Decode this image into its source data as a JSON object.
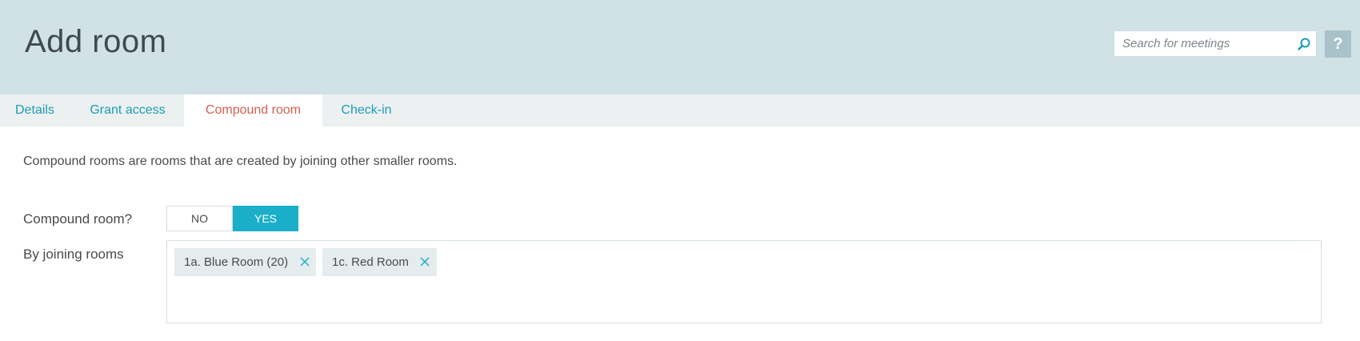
{
  "header": {
    "title": "Add room",
    "search_placeholder": "Search for meetings",
    "help_label": "?"
  },
  "tabs": [
    {
      "label": "Details",
      "active": false
    },
    {
      "label": "Grant access",
      "active": false
    },
    {
      "label": "Compound room",
      "active": true
    },
    {
      "label": "Check-in",
      "active": false
    }
  ],
  "content": {
    "description": "Compound rooms are rooms that are created by joining other smaller rooms.",
    "compound_label": "Compound room?",
    "toggle": {
      "no_label": "NO",
      "yes_label": "YES",
      "selected": "YES"
    },
    "joining_label": "By joining rooms",
    "rooms": [
      {
        "label": "1a. Blue Room (20)"
      },
      {
        "label": "1c. Red Room"
      }
    ]
  },
  "colors": {
    "header_bg": "#d1e2e6",
    "tab_text": "#1a9db8",
    "active_tab_text": "#d3604f",
    "accent": "#1aaec9"
  }
}
